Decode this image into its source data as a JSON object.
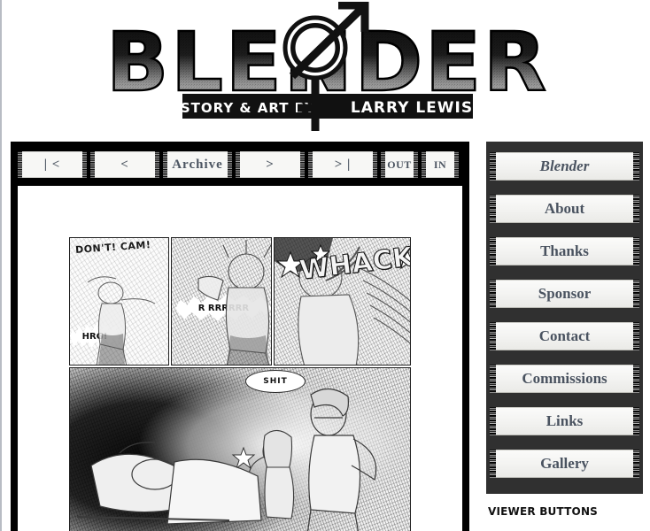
{
  "site": {
    "title": "BLENDER",
    "byline": "STORY & ART BY",
    "author": "LARRY LEWIS"
  },
  "nav": {
    "buttons": [
      {
        "label": "| <",
        "name": "first-page-button"
      },
      {
        "label": "<",
        "name": "previous-page-button"
      },
      {
        "label": "Archive",
        "name": "archive-button"
      },
      {
        "label": ">",
        "name": "next-page-button"
      },
      {
        "label": "> |",
        "name": "last-page-button"
      },
      {
        "label": "OUT",
        "name": "zoom-out-button"
      },
      {
        "label": "IN",
        "name": "zoom-in-button"
      }
    ]
  },
  "sidebar": {
    "items": [
      {
        "label": "Blender",
        "style": "italic"
      },
      {
        "label": "About",
        "style": "normal"
      },
      {
        "label": "Thanks",
        "style": "normal"
      },
      {
        "label": "Sponsor",
        "style": "normal"
      },
      {
        "label": "Contact",
        "style": "normal"
      },
      {
        "label": "Commissions",
        "style": "normal"
      },
      {
        "label": "Links",
        "style": "normal"
      },
      {
        "label": "Gallery",
        "style": "normal"
      }
    ],
    "background_color": "#303030",
    "button_text_color": "#4a5360"
  },
  "viewer": {
    "label": "VIEWER BUTTONS"
  },
  "comic": {
    "lettering": {
      "panel1_shout": "DON'T! CAM!",
      "panel1_grunt": "HRG!",
      "panel2_growl": "R RRRRRR",
      "panel3_sfx": "WHACK!!",
      "panel4_thought": "SHIT"
    }
  },
  "colors": {
    "page_background": "#ffffff",
    "panel_frame": "#000000",
    "button_face": "#f7f7f5",
    "nav_text": "#4c5561",
    "left_rule": "#b8bcc4"
  }
}
